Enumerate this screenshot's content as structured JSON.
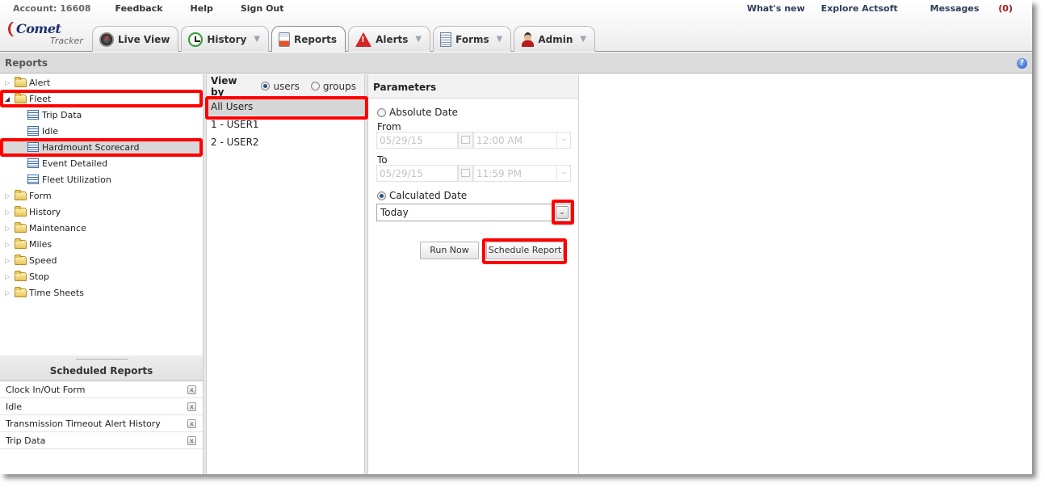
{
  "header": {
    "account_label": "Account: 16608",
    "links_left": [
      "Feedback",
      "Help",
      "Sign Out"
    ],
    "links_right": [
      "What's new",
      "Explore Actsoft"
    ],
    "messages_label": "Messages",
    "messages_count": "(0)",
    "logo_brand": "Comet",
    "logo_sub": "Tracker"
  },
  "tabs": [
    {
      "label": "Live View",
      "icon": "gauge-icon",
      "dropdown": false,
      "active": false
    },
    {
      "label": "History",
      "icon": "clock-icon",
      "dropdown": true,
      "active": false
    },
    {
      "label": "Reports",
      "icon": "report-icon",
      "dropdown": false,
      "active": true
    },
    {
      "label": "Alerts",
      "icon": "warning-icon",
      "dropdown": true,
      "active": false
    },
    {
      "label": "Forms",
      "icon": "document-icon",
      "dropdown": true,
      "active": false
    },
    {
      "label": "Admin",
      "icon": "user-icon",
      "dropdown": true,
      "active": false
    }
  ],
  "caret_glyph": "▼",
  "reports_bar": {
    "title": "Reports",
    "help_glyph": "?"
  },
  "tree": {
    "folders": [
      {
        "label": "Alert",
        "expanded": false
      },
      {
        "label": "Fleet",
        "expanded": true,
        "children": [
          "Trip Data",
          "Idle",
          "Hardmount Scorecard",
          "Event Detailed",
          "Fleet Utilization"
        ],
        "selected_child": "Hardmount Scorecard"
      },
      {
        "label": "Form",
        "expanded": false
      },
      {
        "label": "History",
        "expanded": false
      },
      {
        "label": "Maintenance",
        "expanded": false
      },
      {
        "label": "Miles",
        "expanded": false
      },
      {
        "label": "Speed",
        "expanded": false
      },
      {
        "label": "Stop",
        "expanded": false
      },
      {
        "label": "Time Sheets",
        "expanded": false
      }
    ],
    "collapsed_glyph": "▷",
    "expanded_glyph": "◢"
  },
  "scheduled_reports": {
    "title": "Scheduled Reports",
    "items": [
      "Clock In/Out Form",
      "Idle",
      "Transmission Timeout Alert History",
      "Trip Data"
    ],
    "delete_glyph": "x"
  },
  "view_by": {
    "label": "View by",
    "options": [
      "users",
      "groups"
    ],
    "selected": "users",
    "users": [
      "All Users",
      "1 - USER1",
      "2 - USER2"
    ],
    "selected_user": "All Users"
  },
  "parameters": {
    "title": "Parameters",
    "absolute_label": "Absolute Date",
    "from_label": "From",
    "from_date": "05/29/15",
    "from_time": "12:00 AM",
    "to_label": "To",
    "to_date": "05/29/15",
    "to_time": "11:59 PM",
    "calculated_label": "Calculated Date",
    "calculated_value": "Today",
    "selected_mode": "calculated",
    "dropdown_glyph": "⌄",
    "run_now_label": "Run Now",
    "schedule_label": "Schedule Report"
  },
  "colors": {
    "highlight": "#ff0000",
    "messages_count": "#a31a1a",
    "link": "#2c3e5a"
  }
}
